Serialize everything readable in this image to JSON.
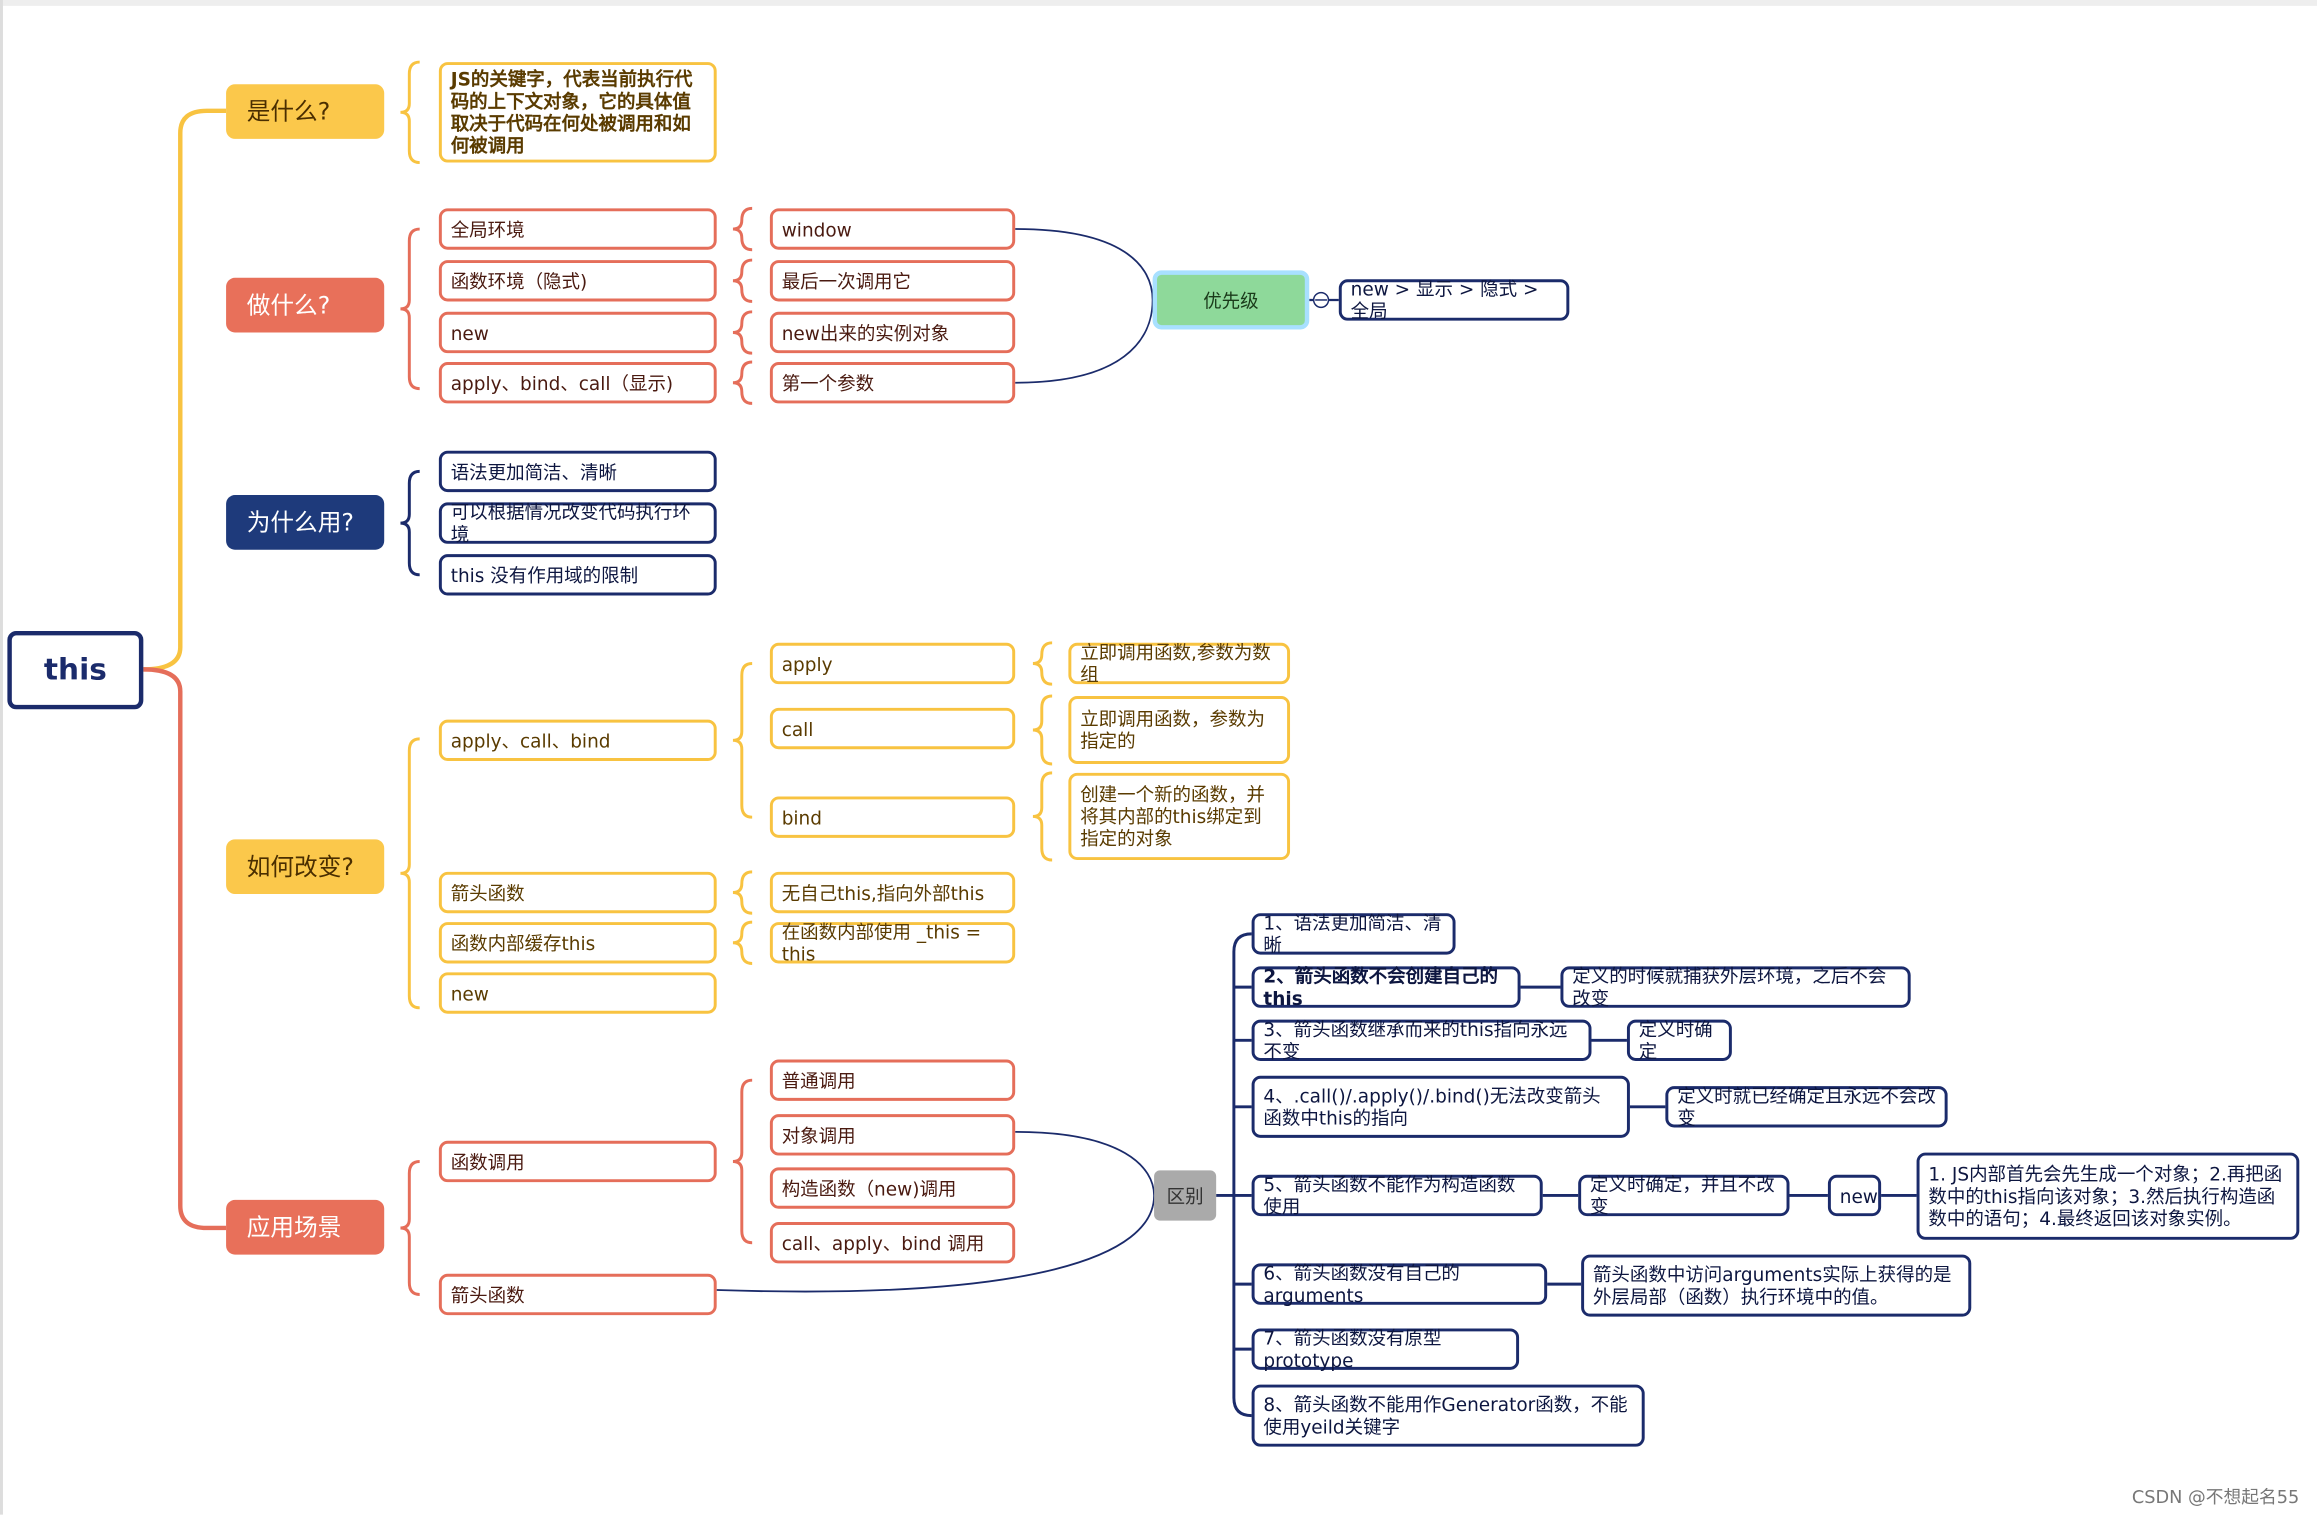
{
  "colors": {
    "yellow": "#F8C341",
    "red": "#E56E5A",
    "navy": "#1B2B6B",
    "green": "#8ED99A"
  },
  "nodes": [
    {
      "id": "root",
      "text": "this",
      "cls": "root"
    },
    {
      "id": "c1",
      "text": "是什么?",
      "cls": "cat cy"
    },
    {
      "id": "c2",
      "text": "做什么?",
      "cls": "cat cr"
    },
    {
      "id": "c3",
      "text": "为什么用?",
      "cls": "cat cn"
    },
    {
      "id": "c4",
      "text": "如何改变?",
      "cls": "cat cy"
    },
    {
      "id": "c5",
      "text": "应用场景",
      "cls": "cat cr"
    },
    {
      "id": "w1",
      "text": "JS的关键字，代表当前执行代码的上下文对象，它的具体值取决于代码在何处被调用和如何被调用",
      "cls": "y bold"
    },
    {
      "id": "d1",
      "text": "全局环境",
      "cls": "r"
    },
    {
      "id": "d2",
      "text": "函数环境（隐式)",
      "cls": "r"
    },
    {
      "id": "d3",
      "text": "new",
      "cls": "r"
    },
    {
      "id": "d4",
      "text": "apply、bind、call（显示)",
      "cls": "r"
    },
    {
      "id": "e1",
      "text": "window",
      "cls": "r"
    },
    {
      "id": "e2",
      "text": "最后一次调用它",
      "cls": "r"
    },
    {
      "id": "e3",
      "text": "new出来的实例对象",
      "cls": "r"
    },
    {
      "id": "e4",
      "text": "第一个参数",
      "cls": "r"
    },
    {
      "id": "pri",
      "text": "优先级",
      "cls": "green"
    },
    {
      "id": "prival",
      "text": "new > 显示 > 隐式 > 全局",
      "cls": "n"
    },
    {
      "id": "u1",
      "text": "语法更加简洁、清晰",
      "cls": "n"
    },
    {
      "id": "u2",
      "text": "可以根据情况改变代码执行环境",
      "cls": "n"
    },
    {
      "id": "u3",
      "text": "this 没有作用域的限制",
      "cls": "n"
    },
    {
      "id": "h1",
      "text": "apply、call、bind",
      "cls": "y"
    },
    {
      "id": "h2",
      "text": "箭头函数",
      "cls": "y"
    },
    {
      "id": "h3",
      "text": "函数内部缓存this",
      "cls": "y"
    },
    {
      "id": "h4",
      "text": "new",
      "cls": "y"
    },
    {
      "id": "a1",
      "text": "apply",
      "cls": "y"
    },
    {
      "id": "a2",
      "text": "call",
      "cls": "y"
    },
    {
      "id": "a3",
      "text": "bind",
      "cls": "y"
    },
    {
      "id": "b1",
      "text": "立即调用函数,参数为数组",
      "cls": "y"
    },
    {
      "id": "b2",
      "text": "立即调用函数，参数为指定的",
      "cls": "y"
    },
    {
      "id": "b3",
      "text": "创建一个新的函数，并将其内部的this绑定到指定的对象",
      "cls": "y"
    },
    {
      "id": "h2c",
      "text": "无自己this,指向外部this",
      "cls": "y"
    },
    {
      "id": "h3c",
      "text": "在函数内部使用 _this = this",
      "cls": "y"
    },
    {
      "id": "s1",
      "text": "函数调用",
      "cls": "r"
    },
    {
      "id": "s2",
      "text": "箭头函数",
      "cls": "r"
    },
    {
      "id": "f1",
      "text": "普通调用",
      "cls": "r"
    },
    {
      "id": "f2",
      "text": "对象调用",
      "cls": "r"
    },
    {
      "id": "f3",
      "text": "构造函数（new)调用",
      "cls": "r"
    },
    {
      "id": "f4",
      "text": "call、apply、bind 调用",
      "cls": "r"
    },
    {
      "id": "diff",
      "text": "区别",
      "cls": "gray"
    },
    {
      "id": "l1",
      "text": "1、语法更加简洁、清晰",
      "cls": "n"
    },
    {
      "id": "l2",
      "text": "2、箭头函数不会创建自己的this",
      "cls": "n bold"
    },
    {
      "id": "l3",
      "text": "3、箭头函数继承而来的this指向永远不变",
      "cls": "n"
    },
    {
      "id": "l4",
      "text": "4、.call()/.apply()/.bind()无法改变箭头函数中this的指向",
      "cls": "n"
    },
    {
      "id": "l5",
      "text": "5、箭头函数不能作为构造函数使用",
      "cls": "n"
    },
    {
      "id": "l6",
      "text": "6、箭头函数没有自己的arguments",
      "cls": "n"
    },
    {
      "id": "l7",
      "text": "7、箭头函数没有原型prototype",
      "cls": "n"
    },
    {
      "id": "l8",
      "text": "8、箭头函数不能用作Generator函数，不能使用yeild关键字",
      "cls": "n"
    },
    {
      "id": "m2",
      "text": "定义的时候就捕获外层环境，之后不会改变",
      "cls": "n"
    },
    {
      "id": "m3",
      "text": "定义时确定",
      "cls": "n"
    },
    {
      "id": "m4",
      "text": "定义时就已经确定且永远不会改变",
      "cls": "n"
    },
    {
      "id": "m5",
      "text": "定义时确定，并且不改变",
      "cls": "n"
    },
    {
      "id": "m5b",
      "text": "new",
      "cls": "n"
    },
    {
      "id": "m5c",
      "text": "1. JS内部首先会先生成一个对象；2.再把函数中的this指向该对象；3.然后执行构造函数中的语句；4.最终返回该对象实例。",
      "cls": "n"
    },
    {
      "id": "m6",
      "text": "箭头函数中访问arguments实际上获得的是外层局部（函数）执行环境中的值。",
      "cls": "n"
    }
  ],
  "watermark": "CSDN @不想起名55"
}
